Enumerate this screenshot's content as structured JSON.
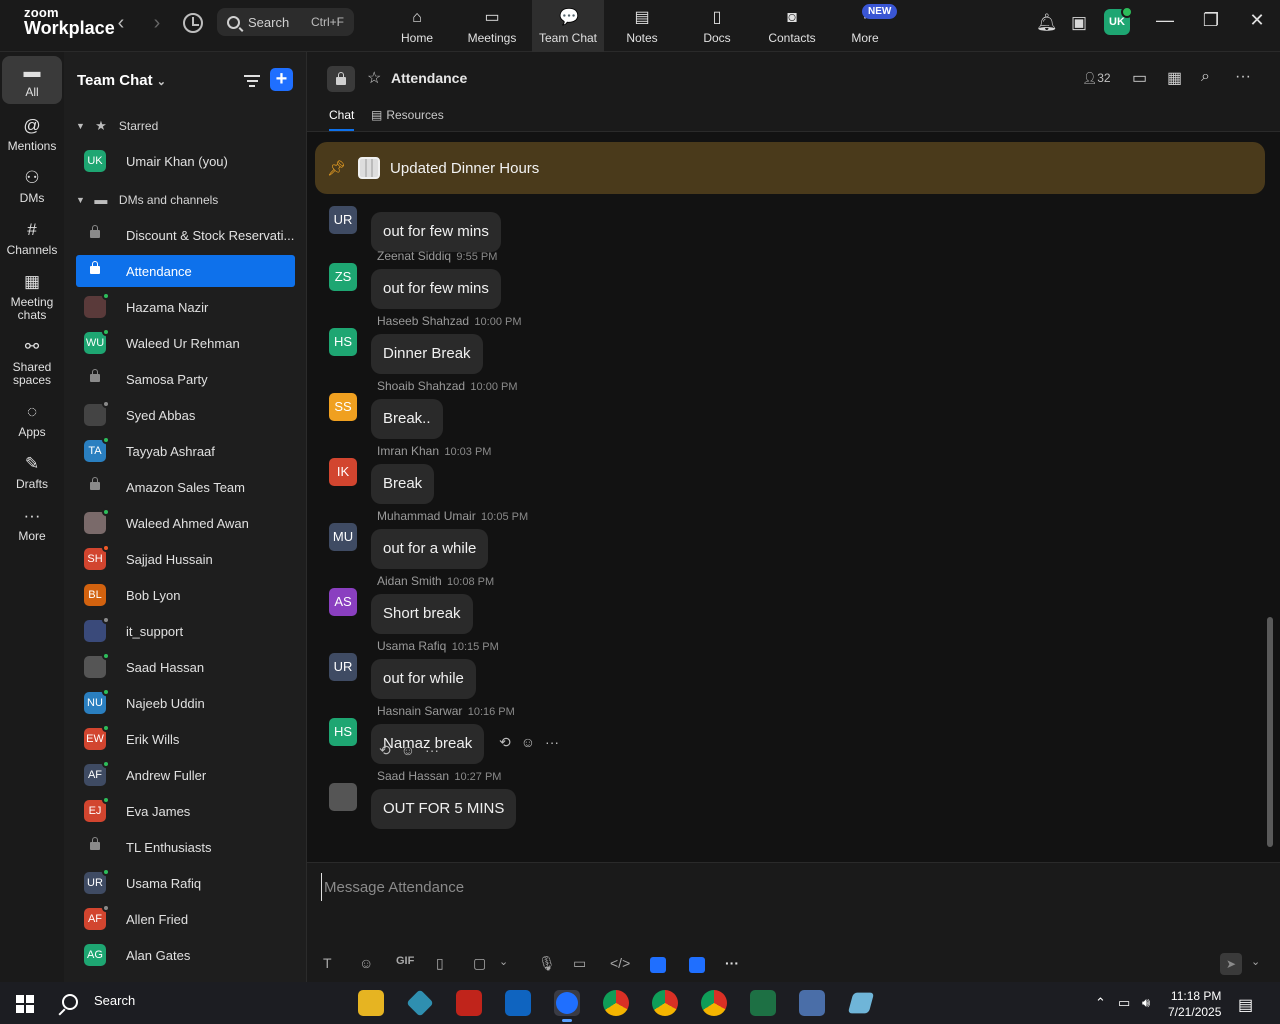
{
  "app": {
    "logo_line1": "zoom",
    "logo_line2": "Workplace",
    "search_label": "Search",
    "search_shortcut": "Ctrl+F",
    "user_initials": "UK",
    "new_badge": "NEW"
  },
  "top_nav": [
    {
      "label": "Home",
      "icon": "home-icon"
    },
    {
      "label": "Meetings",
      "icon": "video-icon"
    },
    {
      "label": "Team Chat",
      "icon": "chat-icon"
    },
    {
      "label": "Notes",
      "icon": "notes-icon"
    },
    {
      "label": "Docs",
      "icon": "docs-icon"
    },
    {
      "label": "Contacts",
      "icon": "contacts-icon"
    },
    {
      "label": "More",
      "icon": "more-icon"
    }
  ],
  "rail": [
    {
      "label": "All",
      "icon": "chat-bubble-icon"
    },
    {
      "label": "Mentions",
      "icon": "at-icon"
    },
    {
      "label": "DMs",
      "icon": "people-icon"
    },
    {
      "label": "Channels",
      "icon": "hash-icon"
    },
    {
      "label": "Meeting chats",
      "icon": "calendar-icon"
    },
    {
      "label": "Shared spaces",
      "icon": "shared-icon"
    },
    {
      "label": "Apps",
      "icon": "apps-icon"
    },
    {
      "label": "Drafts",
      "icon": "drafts-icon"
    },
    {
      "label": "More",
      "icon": "ellipsis-icon"
    }
  ],
  "sidebar": {
    "title": "Team Chat",
    "starred_label": "Starred",
    "dms_label": "DMs and channels",
    "starred": [
      {
        "label": "Umair Khan (you)",
        "initials": "UK",
        "color": "#1ea672",
        "status": ""
      }
    ],
    "items": [
      {
        "label": "Discount & Stock Reservati...",
        "initials": "",
        "color": "lock",
        "status": ""
      },
      {
        "label": "Attendance",
        "initials": "",
        "color": "lock",
        "status": "",
        "active": true
      },
      {
        "label": "Hazama Nazir",
        "initials": "",
        "color": "#5a3a3a",
        "status": "#2dbd5a"
      },
      {
        "label": "Waleed Ur Rehman",
        "initials": "WU",
        "color": "#1ea672",
        "status": "#2dbd5a"
      },
      {
        "label": "Samosa Party",
        "initials": "",
        "color": "lock",
        "status": ""
      },
      {
        "label": "Syed Abbas",
        "initials": "",
        "color": "#444444",
        "status": "#8a8a8a"
      },
      {
        "label": "Tayyab Ashraaf",
        "initials": "TA",
        "color": "#2a7fc0",
        "status": "#2dbd5a"
      },
      {
        "label": "Amazon Sales Team",
        "initials": "",
        "color": "lock",
        "status": ""
      },
      {
        "label": "Waleed Ahmed Awan",
        "initials": "",
        "color": "#7a6a6a",
        "status": "#2dbd5a"
      },
      {
        "label": "Sajjad Hussain",
        "initials": "SH",
        "color": "#d2452f",
        "status": "#f05a28"
      },
      {
        "label": "Bob Lyon",
        "initials": "BL",
        "color": "#d2620f",
        "status": ""
      },
      {
        "label": "it_support",
        "initials": "",
        "color": "#3a4a7a",
        "status": "#8a8a8a"
      },
      {
        "label": "Saad Hassan",
        "initials": "",
        "color": "#555555",
        "status": "#2dbd5a"
      },
      {
        "label": "Najeeb Uddin",
        "initials": "NU",
        "color": "#2a7fc0",
        "status": "#2dbd5a"
      },
      {
        "label": "Erik Wills",
        "initials": "EW",
        "color": "#d2452f",
        "status": "#2dbd5a"
      },
      {
        "label": "Andrew Fuller",
        "initials": "AF",
        "color": "#3f4b63",
        "status": "#2dbd5a"
      },
      {
        "label": "Eva James",
        "initials": "EJ",
        "color": "#d2452f",
        "status": "#2dbd5a"
      },
      {
        "label": "TL Enthusiasts",
        "initials": "",
        "color": "lock",
        "status": ""
      },
      {
        "label": "Usama Rafiq",
        "initials": "UR",
        "color": "#3f4b63",
        "status": "#2dbd5a"
      },
      {
        "label": "Allen Fried",
        "initials": "AF",
        "color": "#d2452f",
        "status": "#8a8a8a"
      },
      {
        "label": "Alan Gates",
        "initials": "AG",
        "color": "#1ea672",
        "status": ""
      }
    ]
  },
  "channel": {
    "title": "Attendance",
    "members": "32",
    "tabs": [
      "Chat",
      "Resources"
    ],
    "pinned": "Updated Dinner Hours",
    "composer_placeholder": "Message Attendance"
  },
  "messages": [
    {
      "sender": "",
      "time": "",
      "text": "out for few mins",
      "initials": "UR",
      "color": "#3f4b63"
    },
    {
      "sender": "Zeenat Siddiq",
      "time": "9:55 PM",
      "text": "out for few mins",
      "initials": "ZS",
      "color": "#1ea672"
    },
    {
      "sender": "Haseeb Shahzad",
      "time": "10:00 PM",
      "text": "Dinner Break",
      "initials": "HS",
      "color": "#1ea672"
    },
    {
      "sender": "Shoaib Shahzad",
      "time": "10:00 PM",
      "text": "Break..",
      "initials": "SS",
      "color": "#f0a020"
    },
    {
      "sender": "Imran Khan",
      "time": "10:03 PM",
      "text": "Break",
      "initials": "IK",
      "color": "#d2452f"
    },
    {
      "sender": "Muhammad Umair",
      "time": "10:05 PM",
      "text": "out for a while",
      "initials": "MU",
      "color": "#3f4b63"
    },
    {
      "sender": "Aidan Smith",
      "time": "10:08 PM",
      "text": "Short break",
      "initials": "AS",
      "color": "#8a3fc0"
    },
    {
      "sender": "Usama Rafiq",
      "time": "10:15 PM",
      "text": "out for while",
      "initials": "UR",
      "color": "#3f4b63"
    },
    {
      "sender": "Hasnain Sarwar",
      "time": "10:16 PM",
      "text": "Namaz break",
      "initials": "HS",
      "color": "#1ea672"
    },
    {
      "sender": "Saad Hassan",
      "time": "10:27 PM",
      "text": "OUT FOR 5 MINS",
      "initials": "",
      "color": "#555555"
    }
  ],
  "composer_tools": [
    "format-icon",
    "emoji-icon",
    "GIF",
    "file-icon",
    "screenshot-icon",
    "chevron-down-icon",
    "mic-icon",
    "video-clip-icon",
    "code-icon",
    "app-icon",
    "app2-icon",
    "ellipsis-icon"
  ],
  "taskbar": {
    "search_label": "Search",
    "time": "11:18 PM",
    "date": "7/21/2025"
  }
}
